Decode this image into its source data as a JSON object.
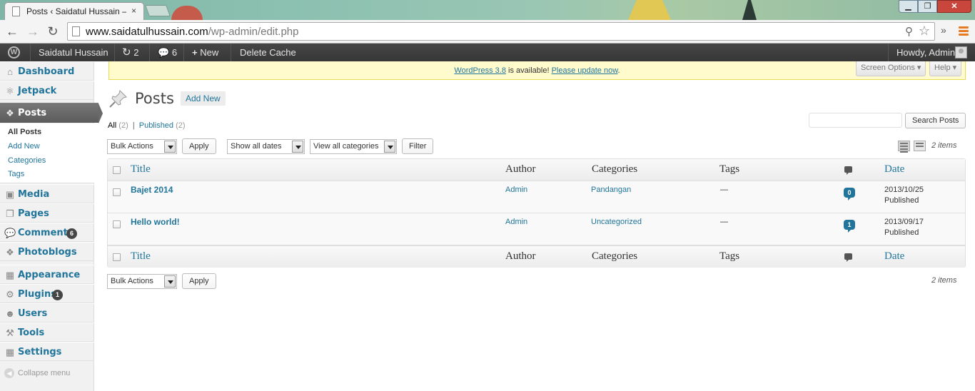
{
  "browser": {
    "tab_title": "Posts ‹ Saidatul Hussain —",
    "tab_close": "×",
    "url_host": "www.saidatulhussain.com",
    "url_path": "/wp-admin/edit.php",
    "window_controls": {
      "minimize": "▁",
      "maximize": "❐",
      "close": "✕"
    },
    "more": "»"
  },
  "adminbar": {
    "site_name": "Saidatul Hussain",
    "updates_count": "2",
    "comments_count": "6",
    "new_label": "New",
    "delete_cache": "Delete Cache",
    "howdy": "Howdy, Admin"
  },
  "sidebar": {
    "items": [
      {
        "label": "Dashboard",
        "icon": "home-icon"
      },
      {
        "label": "Jetpack",
        "icon": "jetpack-icon"
      },
      {
        "label": "Posts",
        "icon": "pushpin-icon"
      },
      {
        "label": "Media",
        "icon": "media-icon"
      },
      {
        "label": "Pages",
        "icon": "pages-icon"
      },
      {
        "label": "Comments",
        "icon": "comments-icon",
        "badge": "6"
      },
      {
        "label": "Photoblogs",
        "icon": "pushpin-icon"
      },
      {
        "label": "Appearance",
        "icon": "appearance-icon"
      },
      {
        "label": "Plugins",
        "icon": "plugins-icon",
        "badge": "1"
      },
      {
        "label": "Users",
        "icon": "users-icon"
      },
      {
        "label": "Tools",
        "icon": "tools-icon"
      },
      {
        "label": "Settings",
        "icon": "settings-icon"
      }
    ],
    "submenu": [
      "All Posts",
      "Add New",
      "Categories",
      "Tags"
    ],
    "collapse": "Collapse menu"
  },
  "notice": {
    "link1": "WordPress 3.8",
    "middle": " is available! ",
    "link2": "Please update now",
    "end": "."
  },
  "screen_meta": {
    "screen_options": "Screen Options ▾",
    "help": "Help ▾"
  },
  "page": {
    "title": "Posts",
    "add_new": "Add New"
  },
  "filters": {
    "all_label": "All",
    "all_count": "(2)",
    "sep": "|",
    "published_label": "Published",
    "published_count": "(2)",
    "search_button": "Search Posts",
    "search_placeholder": "",
    "bulk_actions": "Bulk Actions",
    "apply": "Apply",
    "dates": "Show all dates",
    "categories": "View all categories",
    "filter": "Filter",
    "items_count": "2 items"
  },
  "table": {
    "columns": [
      "Title",
      "Author",
      "Categories",
      "Tags",
      "Date"
    ],
    "rows": [
      {
        "title": "Bajet 2014",
        "author": "Admin",
        "category": "Pandangan",
        "tags": "—",
        "comments": "0",
        "date": "2013/10/25",
        "status": "Published"
      },
      {
        "title": "Hello world!",
        "author": "Admin",
        "category": "Uncategorized",
        "tags": "—",
        "comments": "1",
        "date": "2013/09/17",
        "status": "Published"
      }
    ]
  },
  "colors": {
    "link": "#21759b",
    "adminbar": "#464646",
    "notice_bg": "#fffbcc"
  }
}
